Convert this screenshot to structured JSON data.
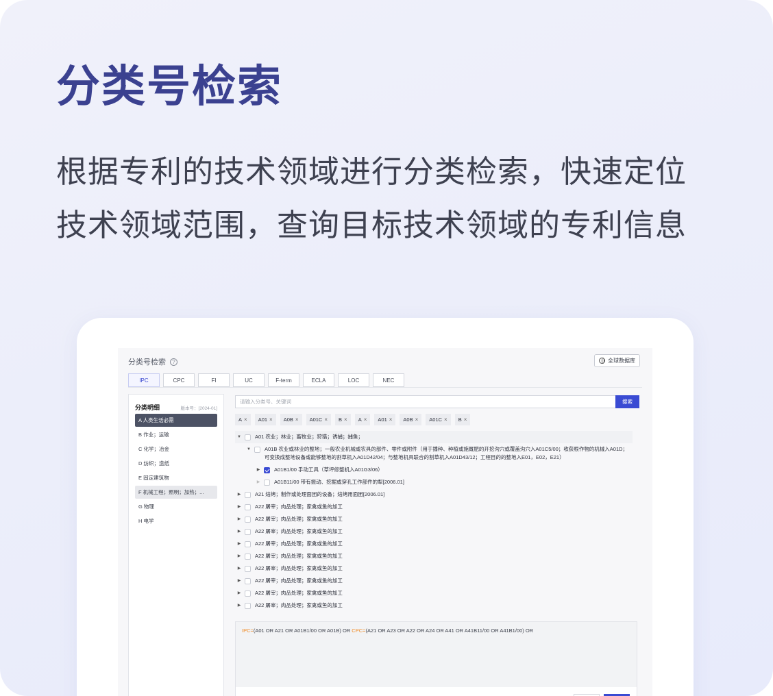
{
  "hero": {
    "title": "分类号检索",
    "desc_line1": "根据专利的技术领域进行分类检索，快速定位",
    "desc_line2": "技术领域范围，查询目标技术领域的专利信息"
  },
  "app": {
    "title": "分类号检索",
    "global_db_label": "全球数据库",
    "tabs": [
      "IPC",
      "CPC",
      "FI",
      "UC",
      "F-term",
      "ECLA",
      "LOC",
      "NEC"
    ],
    "active_tab": "IPC",
    "sidebar": {
      "title": "分类明细",
      "version": "版本号：[2024-01]",
      "items": [
        "A 人类生活必需",
        "B 作业；运输",
        "C 化学；冶金",
        "D 纺织；造纸",
        "E 固定建筑物",
        "F 机械工程；照明；加热；...",
        "G 物理",
        "H 电学"
      ]
    },
    "search": {
      "placeholder": "请输入分类号、关键词",
      "button": "搜索"
    },
    "chips": [
      "A",
      "A01",
      "A0B",
      "A01C",
      "B",
      "A",
      "A01",
      "A0B",
      "A01C",
      "B"
    ],
    "tree": [
      {
        "level": 0,
        "arrow": "▼",
        "checked": false,
        "text": "A01 农业；林业；畜牧业；狩猎；诱捕；捕鱼；"
      },
      {
        "level": 1,
        "arrow": "▼",
        "checked": false,
        "text": "A01B 农业或林业的整地；一般农业机械或农具的部件、零件或附件（用于播种、种植或施厩肥的开挖沟穴或覆盖沟穴入A01C5/00；收获根作物的机械入A01D；可变换成整地设备或能够整地的割草机入A01D42/04；与整地机具联合的割草机入A01D43/12；工程目的的整地入E01，E02，E21）"
      },
      {
        "level": 2,
        "arrow": "▶",
        "checked": true,
        "text": "A01B1/00 手动工具（草坪修整机入A01G3/06）"
      },
      {
        "level": 2,
        "arrow": "▶",
        "checked": false,
        "faint": true,
        "text": "A01B11/00 带有振动、挖掘或穿孔工作部件的犁[2006.01]"
      },
      {
        "level": 0,
        "arrow": "▶",
        "checked": false,
        "text": "A21 焙烤；制作或处理面团的设备；焙烤用面团[2006.01]"
      },
      {
        "level": 0,
        "arrow": "▶",
        "checked": false,
        "text": "A22 屠宰；肉品处理；家禽或鱼的加工"
      },
      {
        "level": 0,
        "arrow": "▶",
        "checked": false,
        "text": "A22 屠宰；肉品处理；家禽或鱼的加工"
      },
      {
        "level": 0,
        "arrow": "▶",
        "checked": false,
        "text": "A22 屠宰；肉品处理；家禽或鱼的加工"
      },
      {
        "level": 0,
        "arrow": "▶",
        "checked": false,
        "text": "A22 屠宰；肉品处理；家禽或鱼的加工"
      },
      {
        "level": 0,
        "arrow": "▶",
        "checked": false,
        "text": "A22 屠宰；肉品处理；家禽或鱼的加工"
      },
      {
        "level": 0,
        "arrow": "▶",
        "checked": false,
        "text": "A22 屠宰；肉品处理；家禽或鱼的加工"
      },
      {
        "level": 0,
        "arrow": "▶",
        "checked": false,
        "text": "A22 屠宰；肉品处理；家禽或鱼的加工"
      },
      {
        "level": 0,
        "arrow": "▶",
        "checked": false,
        "text": "A22 屠宰；肉品处理；家禽或鱼的加工"
      },
      {
        "level": 0,
        "arrow": "▶",
        "checked": false,
        "text": "A22 屠宰；肉品处理；家禽或鱼的加工"
      }
    ],
    "expression": {
      "ipc_key": "IPC=",
      "ipc_value": "(A01 OR A21 OR A01B1/00 OR A01B)  OR  ",
      "cpc_key": "CPC=",
      "cpc_value": "(A21 OR A23 OR A22 OR A24 OR A41 OR A41B11/00 OR A41B1/00) OR"
    },
    "colors": {
      "accent": "#3a4bd3",
      "hero_title": "#3b4190",
      "keyword": "#f08a24",
      "selected_item": "#4c5264"
    }
  }
}
